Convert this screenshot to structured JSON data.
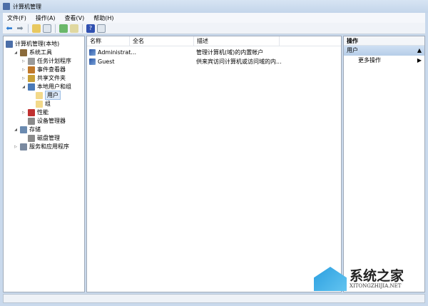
{
  "window": {
    "title": "计算机管理"
  },
  "menu": [
    "文件(F)",
    "操作(A)",
    "查看(V)",
    "帮助(H)"
  ],
  "tree": [
    {
      "label": "计算机管理(本地)",
      "level": 0,
      "arrow": "",
      "color": "#4b6ea8"
    },
    {
      "label": "系统工具",
      "level": 1,
      "arrow": "◢",
      "color": "#8a6a3a"
    },
    {
      "label": "任务计划程序",
      "level": 2,
      "arrow": "▷",
      "color": "#9a9a9a"
    },
    {
      "label": "事件查看器",
      "level": 2,
      "arrow": "▷",
      "color": "#c0782a"
    },
    {
      "label": "共享文件夹",
      "level": 2,
      "arrow": "▷",
      "color": "#c8a038"
    },
    {
      "label": "本地用户和组",
      "level": 2,
      "arrow": "◢",
      "color": "#4a7ab8"
    },
    {
      "label": "用户",
      "level": 3,
      "arrow": "",
      "color": "#f3d98a",
      "selected": true
    },
    {
      "label": "组",
      "level": 3,
      "arrow": "",
      "color": "#f3d98a"
    },
    {
      "label": "性能",
      "level": 2,
      "arrow": "▷",
      "color": "#c03030"
    },
    {
      "label": "设备管理器",
      "level": 2,
      "arrow": "",
      "color": "#8a8a8a"
    },
    {
      "label": "存储",
      "level": 1,
      "arrow": "◢",
      "color": "#6a8ab0"
    },
    {
      "label": "磁盘管理",
      "level": 2,
      "arrow": "",
      "color": "#8a8a8a"
    },
    {
      "label": "服务和应用程序",
      "level": 1,
      "arrow": "▷",
      "color": "#7a8aa0"
    }
  ],
  "columns": [
    "名称",
    "全名",
    "描述"
  ],
  "users": [
    {
      "name": "Administrat...",
      "fullname": "",
      "desc": "管理计算机(域)的内置帐户"
    },
    {
      "name": "Guest",
      "fullname": "",
      "desc": "供来宾访问计算机或访问域的内..."
    }
  ],
  "actions": {
    "header": "操作",
    "section": "用户",
    "item": "更多操作"
  },
  "watermark": {
    "cn": "系统之家",
    "en": "XITONGZHIJIA.NET"
  }
}
